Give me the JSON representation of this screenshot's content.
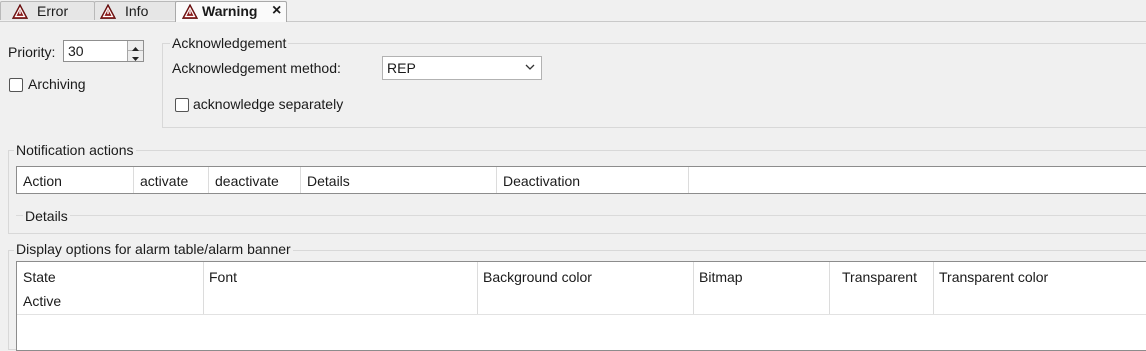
{
  "tabs": [
    {
      "label": "Error",
      "icon": "warning-triangle-icon"
    },
    {
      "label": "Info",
      "icon": "warning-triangle-icon"
    },
    {
      "label": "Warning",
      "icon": "warning-triangle-icon",
      "active": true
    }
  ],
  "tab_close_glyph": "×",
  "priority": {
    "label": "Priority:",
    "value": "30"
  },
  "archiving": {
    "label": "Archiving",
    "checked": false
  },
  "acknowledgement": {
    "title": "Acknowledgement",
    "method_label": "Acknowledgement method:",
    "method_value": "REP",
    "separately_label": "acknowledge separately",
    "separately_checked": false
  },
  "notification": {
    "title": "Notification actions",
    "columns": [
      "Action",
      "activate",
      "deactivate",
      "Details",
      "Deactivation"
    ],
    "details_label": "Details"
  },
  "display": {
    "title": "Display options for alarm table/alarm banner",
    "columns": [
      "State",
      "Font",
      "Background color",
      "Bitmap",
      "Transparent",
      "Transparent color"
    ],
    "rows": [
      [
        "Active",
        "",
        "",
        "",
        "",
        ""
      ]
    ]
  },
  "colors": {
    "warning_icon_fill": "#8b1a1a",
    "warning_icon_stroke": "#ffffff"
  }
}
